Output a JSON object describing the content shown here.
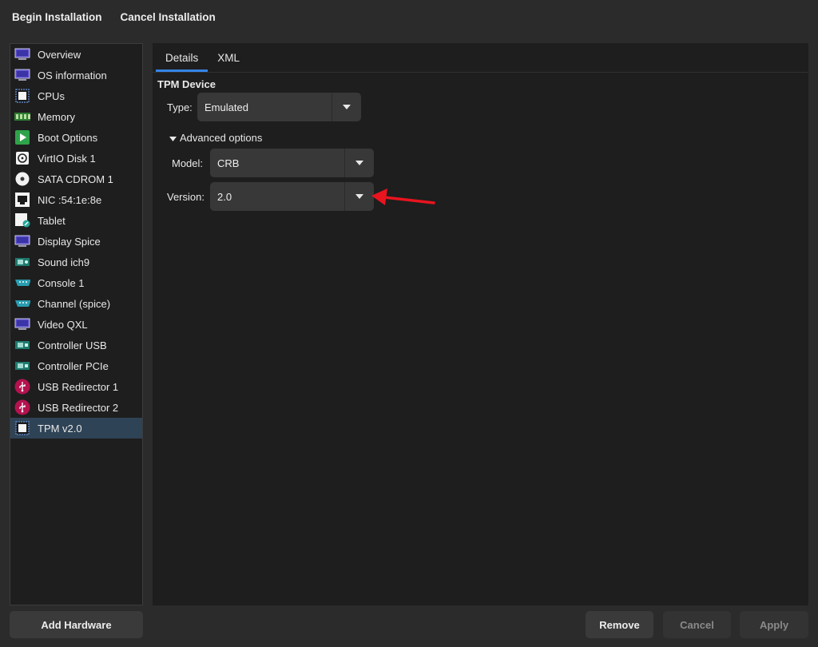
{
  "toolbar": {
    "begin_label": "Begin Installation",
    "cancel_label": "Cancel Installation"
  },
  "sidebar": {
    "items": [
      {
        "label": "Overview",
        "icon": "monitor-icon"
      },
      {
        "label": "OS information",
        "icon": "monitor-icon"
      },
      {
        "label": "CPUs",
        "icon": "chip-icon"
      },
      {
        "label": "Memory",
        "icon": "ram-icon"
      },
      {
        "label": "Boot Options",
        "icon": "boot-icon"
      },
      {
        "label": "VirtIO Disk 1",
        "icon": "disk-icon"
      },
      {
        "label": "SATA CDROM 1",
        "icon": "cdrom-icon"
      },
      {
        "label": "NIC :54:1e:8e",
        "icon": "network-port-icon"
      },
      {
        "label": "Tablet",
        "icon": "tablet-icon"
      },
      {
        "label": "Display Spice",
        "icon": "monitor-icon"
      },
      {
        "label": "Sound ich9",
        "icon": "sound-card-icon"
      },
      {
        "label": "Console 1",
        "icon": "serial-port-icon"
      },
      {
        "label": "Channel (spice)",
        "icon": "serial-port-icon"
      },
      {
        "label": "Video QXL",
        "icon": "monitor-icon"
      },
      {
        "label": "Controller USB",
        "icon": "controller-card-icon"
      },
      {
        "label": "Controller PCIe",
        "icon": "controller-card-icon"
      },
      {
        "label": "USB Redirector 1",
        "icon": "usb-icon"
      },
      {
        "label": "USB Redirector 2",
        "icon": "usb-icon"
      },
      {
        "label": "TPM v2.0",
        "icon": "chip-icon",
        "selected": true
      }
    ]
  },
  "tabs": [
    {
      "label": "Details",
      "active": true
    },
    {
      "label": "XML",
      "active": false
    }
  ],
  "details": {
    "section_title": "TPM Device",
    "type_label": "Type:",
    "type_value": "Emulated",
    "advanced_label": "Advanced options",
    "model_label": "Model:",
    "model_value": "CRB",
    "version_label": "Version:",
    "version_value": "2.0"
  },
  "buttons": {
    "add_hardware": "Add Hardware",
    "remove": "Remove",
    "cancel": "Cancel",
    "apply": "Apply"
  },
  "colors": {
    "accent": "#3584e4",
    "selection": "#2f4356",
    "annotation_arrow": "#e8141e"
  }
}
